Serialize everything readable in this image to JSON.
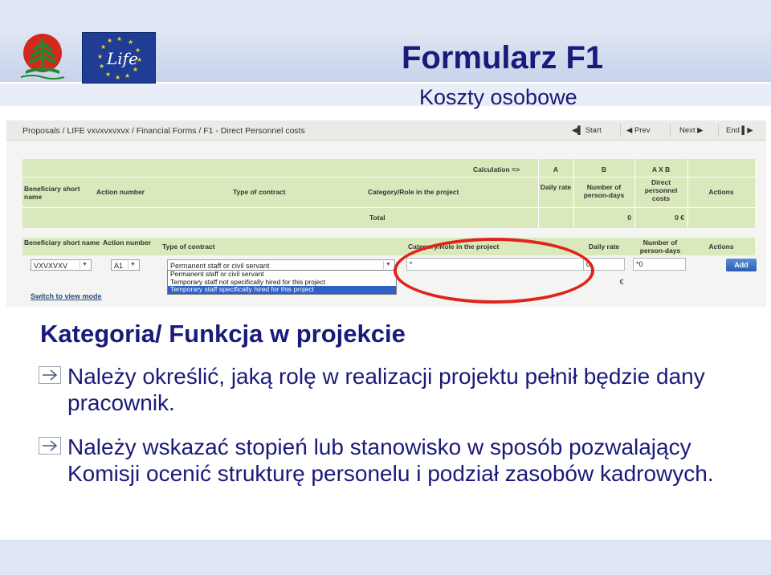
{
  "slide": {
    "title": "Formularz F1",
    "subtitle": "Koszty osobowe",
    "logo_life_text": "Life"
  },
  "screenshot": {
    "breadcrumb": "Proposals / LIFE vxvxvxvxvx / Financial Forms / F1 - Direct Personnel costs",
    "nav": {
      "start": "Start",
      "prev": "Prev",
      "next": "Next",
      "end": "End"
    },
    "summary_table": {
      "calc_label": "Calculation =>",
      "col_a": "A",
      "col_b": "B",
      "col_axb": "A X B",
      "headers": [
        "Beneficiary short name",
        "Action number",
        "Type of contract",
        "Category/Role in the project",
        "Daily rate",
        "Number of person-days",
        "Direct personnel costs",
        "Actions"
      ],
      "total_label": "Total",
      "total_days": "0",
      "total_costs": "0 €"
    },
    "entry_table": {
      "headers": [
        "Beneficiary short name",
        "Action number",
        "Type of contract",
        "Category/Role in the project",
        "Daily rate",
        "Number of person-days",
        "Actions"
      ],
      "beneficiary_value": "VXVXVXV",
      "action_value": "A1",
      "contract_value": "Permanent staff or civil servant",
      "role_value": "*",
      "rate_value": "0",
      "days_value": "*0",
      "euro": "€",
      "add_label": "Add",
      "dropdown_options": [
        "Permanent staff or civil servant",
        "Temporary staff not specifically hired for this project",
        "Temporary staff specifically hired for this project"
      ],
      "switch_link": "Switch to view mode"
    }
  },
  "content": {
    "heading": "Kategoria/ Funkcja w projekcie",
    "bullets": [
      "Należy określić, jaką rolę w realizacji projektu pełnił będzie dany pracownik.",
      "Należy wskazać stopień lub stanowisko w sposób pozwalający Komisji ocenić strukturę personelu i podział zasobów kadrowych."
    ]
  },
  "colors": {
    "title": "#1a1a7a",
    "table_header": "#d9e9bb",
    "highlight_ring": "#e0241b",
    "eu_blue": "#1f3d94"
  }
}
